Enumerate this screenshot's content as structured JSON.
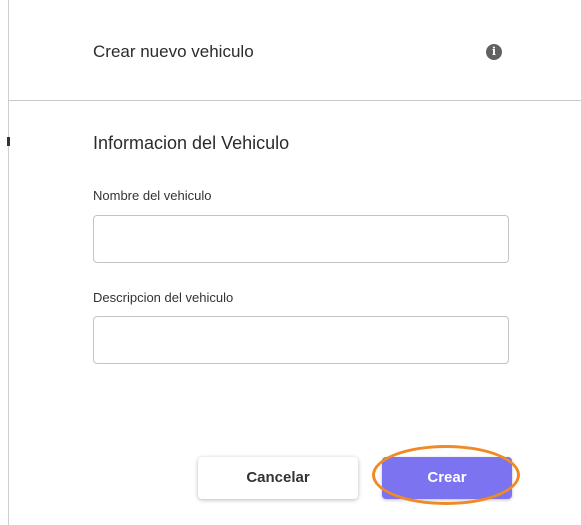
{
  "dialog": {
    "title": "Crear nuevo vehiculo",
    "info_icon": "info-icon"
  },
  "form": {
    "section_title": "Informacion del Vehiculo",
    "name_label": "Nombre del vehiculo",
    "name_value": "",
    "description_label": "Descripcion del vehiculo",
    "description_value": ""
  },
  "actions": {
    "cancel_label": "Cancelar",
    "create_label": "Crear"
  },
  "colors": {
    "primary": "#7b73f0",
    "highlight": "#f08a24"
  }
}
